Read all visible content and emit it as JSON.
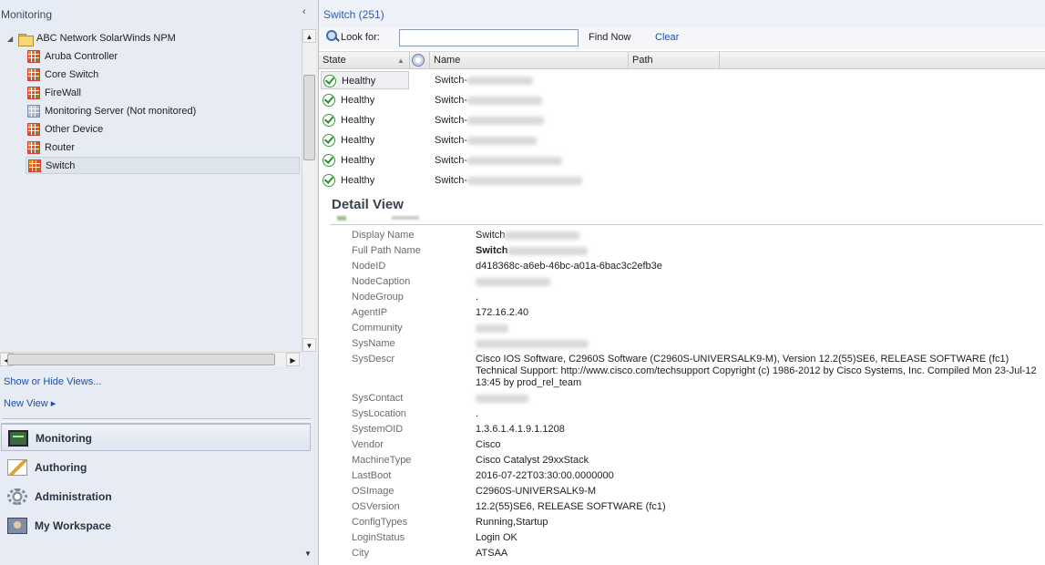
{
  "left_pane": {
    "title": "Monitoring",
    "collapse_glyph": "‹",
    "tree": {
      "root": {
        "label": "ABC Network SolarWinds NPM",
        "expander": "◢"
      },
      "children": [
        {
          "label": "Aruba Controller",
          "icon": "state-view-icon"
        },
        {
          "label": "Core Switch",
          "icon": "state-view-icon"
        },
        {
          "label": "FireWall",
          "icon": "state-view-icon"
        },
        {
          "label": "Monitoring Server (Not monitored)",
          "icon": "state-view-icon"
        },
        {
          "label": "Other Device",
          "icon": "state-view-icon"
        },
        {
          "label": "Router",
          "icon": "state-view-icon"
        },
        {
          "label": "Switch",
          "icon": "state-view-icon",
          "selected": true
        }
      ]
    },
    "links": {
      "show_hide": "Show or Hide Views...",
      "new_view": "New View ▸"
    },
    "wunderbar": [
      {
        "label": "Monitoring",
        "icon": "monitoring-icon",
        "active": true
      },
      {
        "label": "Authoring",
        "icon": "authoring-icon"
      },
      {
        "label": "Administration",
        "icon": "administration-icon"
      },
      {
        "label": "My Workspace",
        "icon": "my-workspace-icon"
      }
    ],
    "overflow_glyph": "▼"
  },
  "right_pane": {
    "title": "Switch (251)",
    "search": {
      "label": "Look for:",
      "value": "",
      "find_now": "Find Now",
      "clear": "Clear"
    },
    "columns": {
      "state": "State",
      "name": "Name",
      "path": "Path",
      "sort_glyph": "▲"
    },
    "rows": [
      {
        "state": "Healthy",
        "name_prefix": "Switch-"
      },
      {
        "state": "Healthy",
        "name_prefix": "Switch-"
      },
      {
        "state": "Healthy",
        "name_prefix": "Switch-"
      },
      {
        "state": "Healthy",
        "name_prefix": "Switch-"
      },
      {
        "state": "Healthy",
        "name_prefix": "Switch-"
      },
      {
        "state": "Healthy",
        "name_prefix": "Switch-"
      }
    ],
    "detail": {
      "title": "Detail View",
      "properties": [
        {
          "key": "Display Name",
          "value": "Switch"
        },
        {
          "key": "Full Path Name",
          "value": "Switch"
        },
        {
          "key": "NodeID",
          "value": "d418368c-a6eb-46bc-a01a-6bac3c2efb3e"
        },
        {
          "key": "NodeCaption",
          "value": ""
        },
        {
          "key": "NodeGroup",
          "value": "."
        },
        {
          "key": "AgentIP",
          "value": "172.16.2.40"
        },
        {
          "key": "Community",
          "value": ""
        },
        {
          "key": "SysName",
          "value": ""
        },
        {
          "key": "SysDescr",
          "value": "Cisco IOS Software, C2960S Software (C2960S-UNIVERSALK9-M), Version 12.2(55)SE6, RELEASE SOFTWARE (fc1) Technical Support: http://www.cisco.com/techsupport Copyright (c) 1986-2012 by Cisco Systems, Inc. Compiled Mon 23-Jul-12 13:45 by prod_rel_team"
        },
        {
          "key": "SysContact",
          "value": ""
        },
        {
          "key": "SysLocation",
          "value": "."
        },
        {
          "key": "SystemOID",
          "value": "1.3.6.1.4.1.9.1.1208"
        },
        {
          "key": "Vendor",
          "value": "Cisco"
        },
        {
          "key": "MachineType",
          "value": "Cisco Catalyst 29xxStack"
        },
        {
          "key": "LastBoot",
          "value": "2016-07-22T03:30:00.0000000"
        },
        {
          "key": "OSImage",
          "value": "C2960S-UNIVERSALK9-M"
        },
        {
          "key": "OSVersion",
          "value": "12.2(55)SE6, RELEASE SOFTWARE (fc1)"
        },
        {
          "key": "ConfigTypes",
          "value": "Running,Startup"
        },
        {
          "key": "LoginStatus",
          "value": "Login OK"
        },
        {
          "key": "City",
          "value": "ATSAA"
        }
      ]
    }
  },
  "colors": {
    "accent_blue": "#2f5ea7",
    "link_blue": "#1f50a6",
    "healthy_green": "#3a9a3a",
    "pane_bg": "#e6ebf4"
  }
}
